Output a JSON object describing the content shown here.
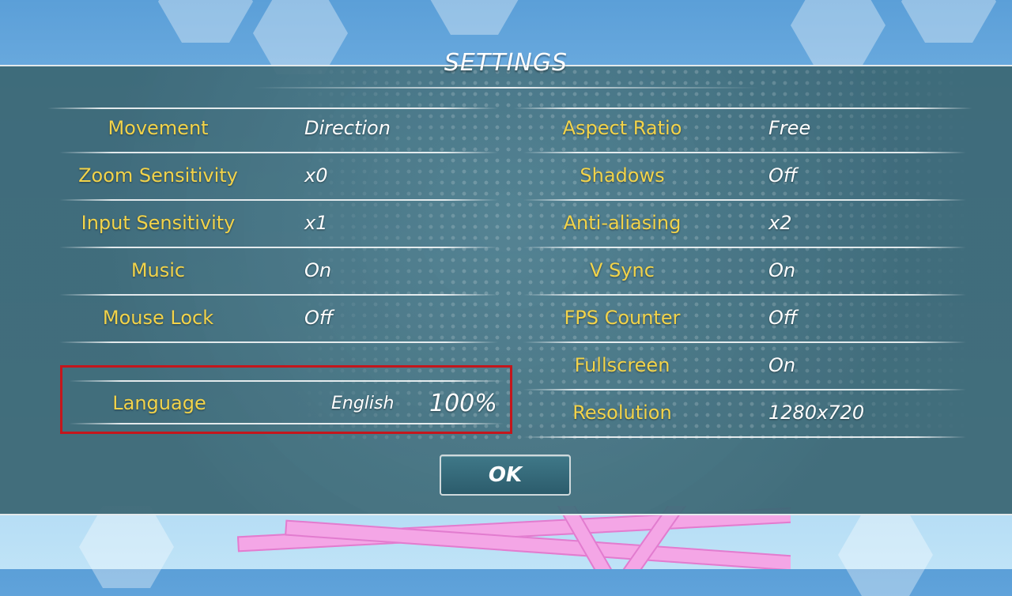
{
  "title": "SETTINGS",
  "left_settings": [
    {
      "label": "Movement",
      "value": "Direction"
    },
    {
      "label": "Zoom Sensitivity",
      "value": "x0"
    },
    {
      "label": "Input Sensitivity",
      "value": "x1"
    },
    {
      "label": "Music",
      "value": "On"
    },
    {
      "label": "Mouse Lock",
      "value": "Off"
    }
  ],
  "language": {
    "label": "Language",
    "value": "English",
    "completion": "100%"
  },
  "right_settings": [
    {
      "label": "Aspect Ratio",
      "value": "Free"
    },
    {
      "label": "Shadows",
      "value": "Off"
    },
    {
      "label": "Anti-aliasing",
      "value": "x2"
    },
    {
      "label": "V Sync",
      "value": "On"
    },
    {
      "label": "FPS Counter",
      "value": "Off"
    },
    {
      "label": "Fullscreen",
      "value": "On"
    },
    {
      "label": "Resolution",
      "value": "1280x720"
    }
  ],
  "ok_button": {
    "label": "OK"
  },
  "colors": {
    "label": "#f2d34a",
    "value": "#ffffff",
    "panel": "#4f7e8c",
    "highlight_box": "#c4161c"
  }
}
